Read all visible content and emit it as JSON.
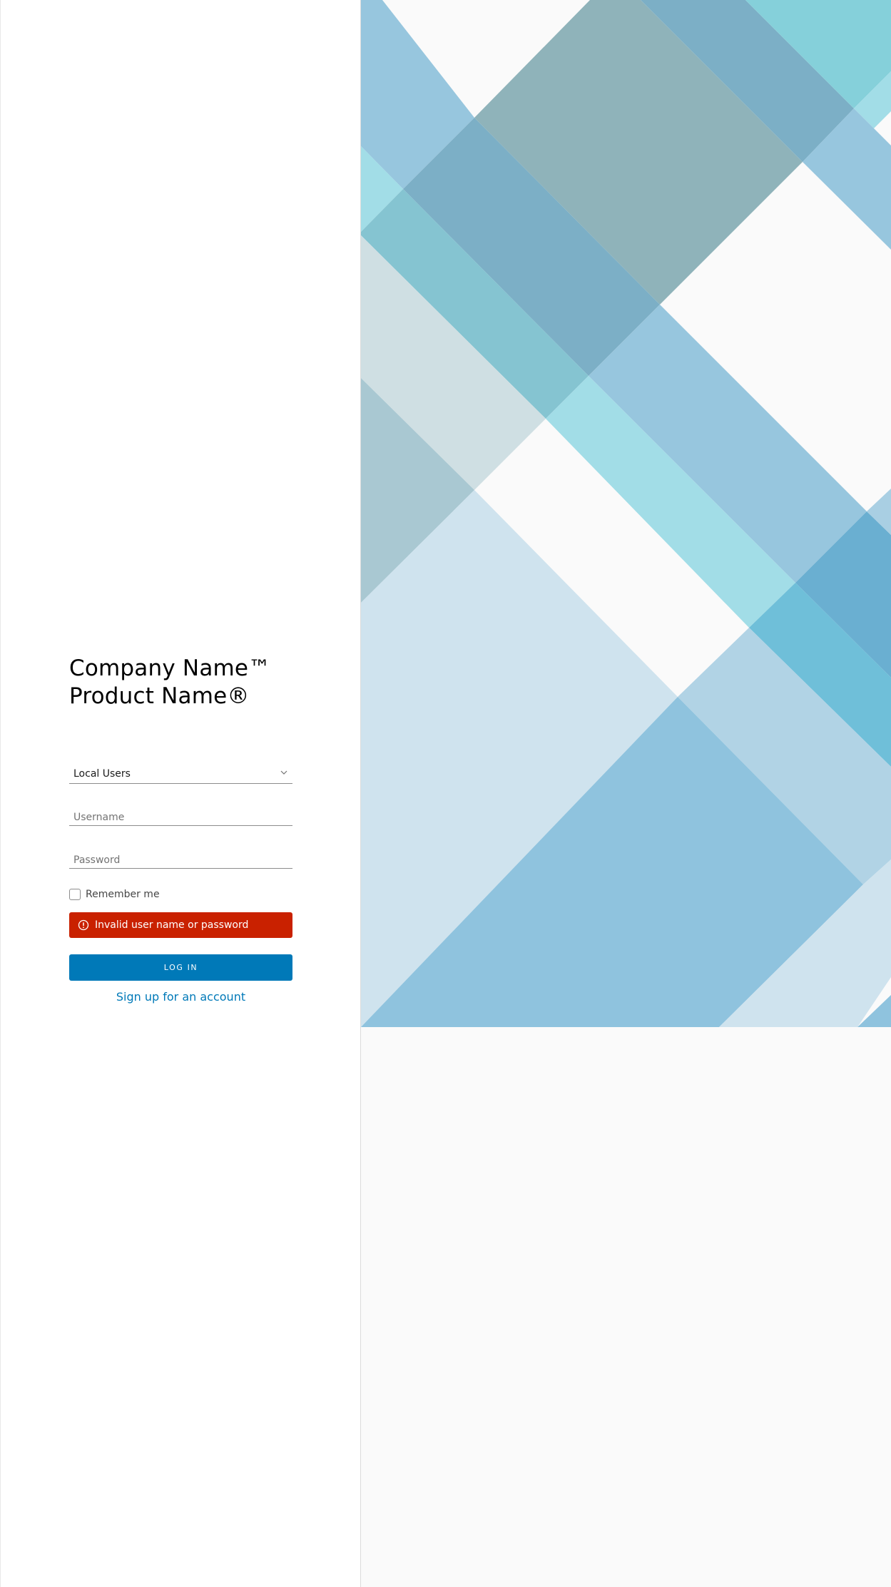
{
  "header": {
    "company_name": "Company Name™",
    "product_name": "Product Name®"
  },
  "form": {
    "auth_source": {
      "selected": "Local Users",
      "icon": "chevron-down-icon"
    },
    "username": {
      "placeholder": "Username",
      "value": ""
    },
    "password": {
      "placeholder": "Password",
      "value": ""
    },
    "remember_label": "Remember me",
    "remember_checked": false,
    "error": {
      "icon": "exclamation-circle-icon",
      "message": "Invalid user name or password"
    },
    "login_label": "LOG IN",
    "signup_label": "Sign up for an account"
  },
  "colors": {
    "primary": "#0079b8",
    "error": "#c92100",
    "panel_background": "#ffffff",
    "page_background": "#fafafa"
  }
}
